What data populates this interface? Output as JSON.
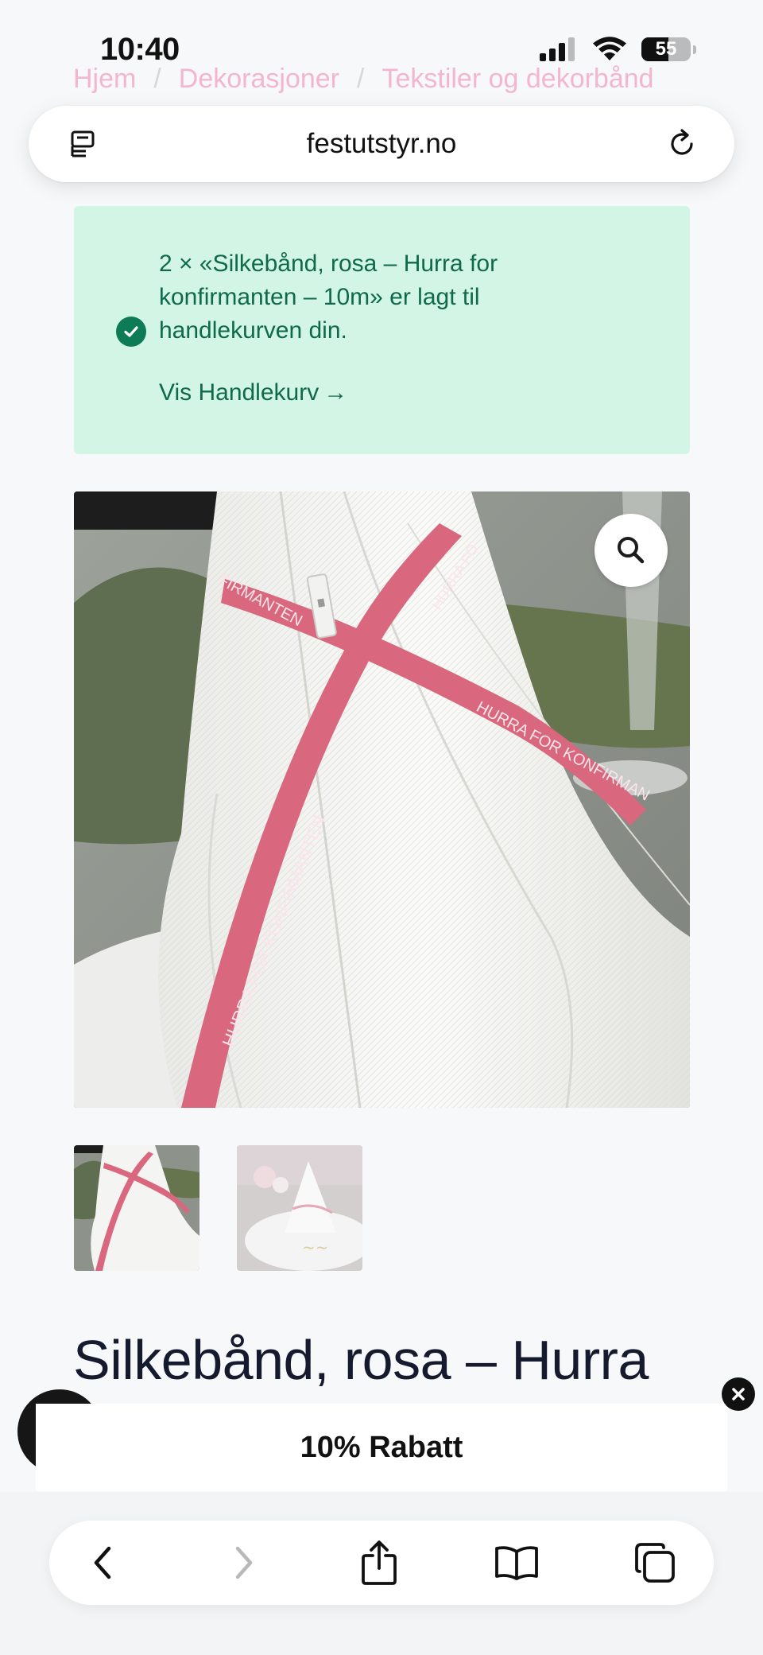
{
  "status_bar": {
    "time": "10:40",
    "battery_percent": "55",
    "battery_level": 0.55
  },
  "breadcrumb": {
    "items": [
      "Hjem",
      "Dekorasjoner",
      "Tekstiler og dekorbånd"
    ],
    "separator": "/"
  },
  "browser": {
    "url": "festutstyr.no"
  },
  "notice": {
    "message": "2 × «Silkebånd, rosa – Hurra for konfirmanten – 10m» er lagt til handlekurven din.",
    "link_label": "Vis Handlekurv",
    "link_arrow": "→",
    "colors": {
      "background": "#d3f5e6",
      "text": "#0e6a4b",
      "icon": "#0d7b55"
    }
  },
  "product": {
    "title": "Silkebånd, rosa – Hurra",
    "ribbon_text": "HURRA FOR KONFIRMANTEN",
    "ribbon_text_partial_top": "FIRMANTEN",
    "ribbon_text_partial_right": "HURRA FOR KONFIRMAN",
    "ribbon_text_vertical": "HURRA FO",
    "ribbon_color": "#d9677d"
  },
  "popup": {
    "discount_label": "10% Rabatt"
  },
  "icons": {
    "reader": "reader-icon",
    "reload": "reload-icon",
    "zoom": "search-icon",
    "close": "close-icon",
    "chat": "chat-icon",
    "back": "chevron-left-icon",
    "forward": "chevron-right-icon",
    "share": "share-icon",
    "bookmarks": "book-icon",
    "tabs": "tabs-icon"
  }
}
